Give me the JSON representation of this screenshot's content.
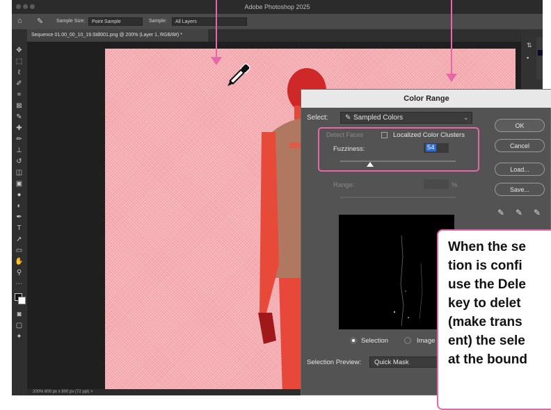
{
  "window": {
    "title": "Adobe Photoshop 2025"
  },
  "options_bar": {
    "sample_size_label": "Sample Size:",
    "sample_size_value": "Point Sample",
    "sample_label": "Sample:",
    "sample_value": "All Layers"
  },
  "document_tab": {
    "label": "Sequence 01.00_00_10_19.Still001.png @ 200% (Layer 1, RGB/8#) *"
  },
  "status_bar": {
    "text": "200%     800 px x 800 px (72 ppi)     >"
  },
  "dialog": {
    "title": "Color Range",
    "select_label": "Select:",
    "select_value": "Sampled Colors",
    "detect_faces_label": "Detect Faces",
    "localized_label": "Localized Color Clusters",
    "fuzziness_label": "Fuzziness:",
    "fuzziness_value": "54",
    "range_label": "Range:",
    "range_unit": "%",
    "buttons": {
      "ok": "OK",
      "cancel": "Cancel",
      "load": "Load...",
      "save": "Save..."
    },
    "selection_radio": "Selection",
    "image_radio": "Image",
    "preview_label": "Selection Preview:",
    "preview_value": "Quick Mask"
  },
  "callout": {
    "lines": [
      "When the se",
      "tion is confi",
      "use the Dele",
      "key to delet",
      "(make trans",
      "ent) the sele",
      "at the bound"
    ]
  },
  "colors": {
    "accent_pink": "#e668a8",
    "mask_red": "#f2a0a6"
  }
}
